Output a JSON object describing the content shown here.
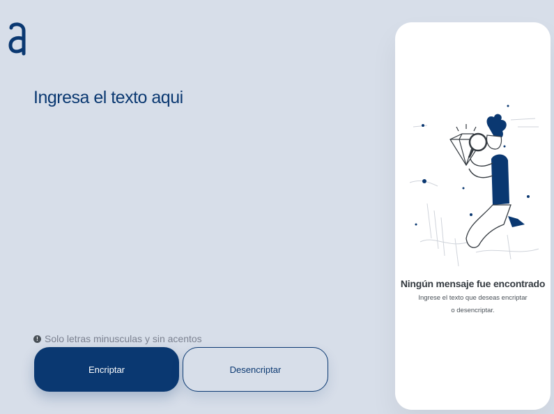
{
  "input": {
    "placeholder": "Ingresa el texto aqui"
  },
  "hint": {
    "icon": "info-icon",
    "icon_glyph": "!",
    "text": "Solo letras minusculas y sin acentos"
  },
  "buttons": {
    "encrypt_label": "Encriptar",
    "decrypt_label": "Desencriptar"
  },
  "output": {
    "title": "Ningún mensaje fue encontrado",
    "subtitle": "Ingrese el texto que deseas encriptar o desencriptar."
  },
  "colors": {
    "background": "#d7dee9",
    "primary": "#0a3871",
    "panel": "#ffffff",
    "hint_text": "#7b8190"
  },
  "icons": {
    "logo": "alura-logo",
    "illustration": "person-with-magnifier-illustration"
  }
}
